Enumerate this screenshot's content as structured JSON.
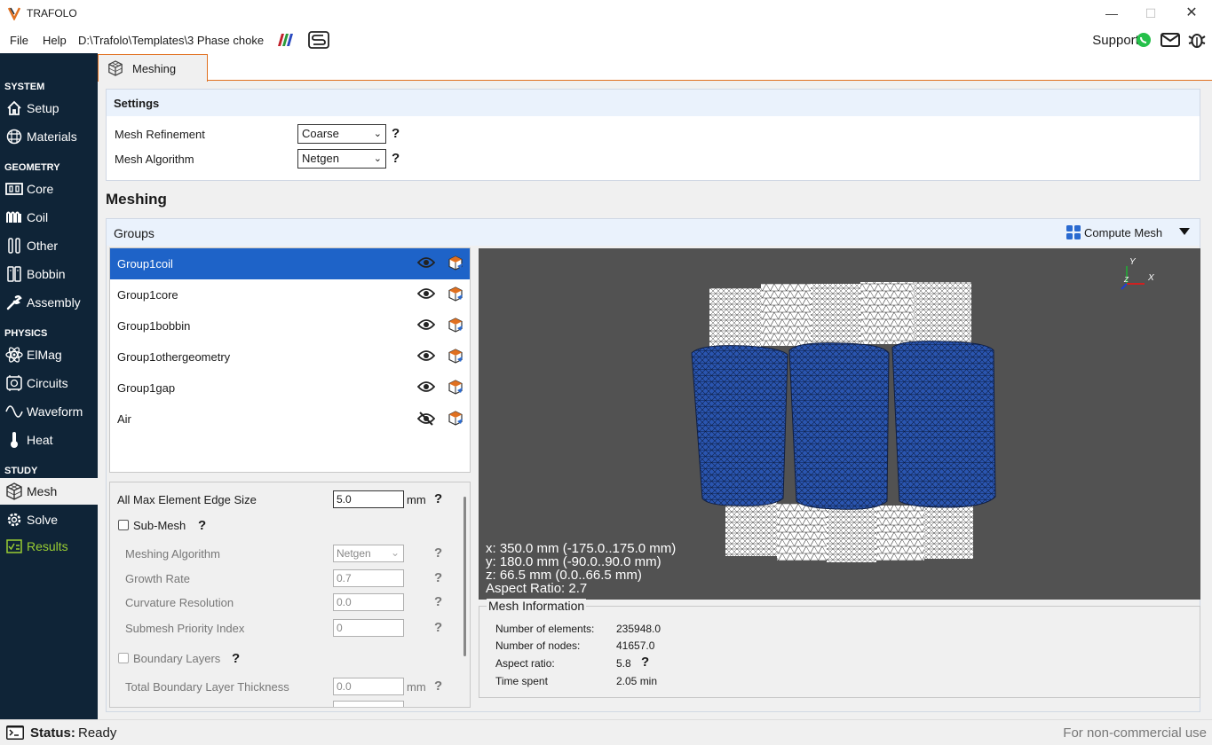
{
  "window": {
    "title": "TRAFOLO",
    "minimize": "—",
    "maximize": "☐",
    "close": "✕"
  },
  "menu": {
    "file": "File",
    "help": "Help",
    "path": "D:\\Trafolo\\Templates\\3 Phase choke",
    "support": "Support:"
  },
  "sidebar": {
    "system": "SYSTEM",
    "geometry": "GEOMETRY",
    "physics": "PHYSICS",
    "study": "STUDY",
    "items": {
      "setup": "Setup",
      "materials": "Materials",
      "core": "Core",
      "coil": "Coil",
      "other": "Other",
      "bobbin": "Bobbin",
      "assembly": "Assembly",
      "elmag": "ElMag",
      "circuits": "Circuits",
      "waveform": "Waveform",
      "heat": "Heat",
      "mesh": "Mesh",
      "solve": "Solve",
      "results": "Results"
    }
  },
  "tab": {
    "label": "Meshing"
  },
  "settings": {
    "title": "Settings",
    "refinement_label": "Mesh Refinement",
    "refinement_value": "Coarse",
    "algorithm_label": "Mesh Algorithm",
    "algorithm_value": "Netgen",
    "help": "?"
  },
  "meshing": {
    "heading": "Meshing",
    "groups_label": "Groups",
    "compute_label": "Compute Mesh",
    "groups": [
      "Group1coil",
      "Group1core",
      "Group1bobbin",
      "Group1othergeometry",
      "Group1gap",
      "Air"
    ]
  },
  "params": {
    "max_edge_label": "All Max Element Edge Size",
    "max_edge_value": "5.0",
    "unit": "mm",
    "submesh_label": "Sub-Mesh",
    "algo_label": "Meshing Algorithm",
    "algo_value": "Netgen",
    "growth_label": "Growth Rate",
    "growth_value": "0.7",
    "curv_label": "Curvature Resolution",
    "curv_value": "0.0",
    "prio_label": "Submesh Priority Index",
    "prio_value": "0",
    "boundary_label": "Boundary Layers",
    "total_bl_label": "Total Boundary Layer Thickness",
    "total_bl_value": "0.0",
    "help": "?"
  },
  "viewport": {
    "x_info": "x: 350.0 mm (-175.0..175.0 mm)",
    "y_info": "y: 180.0 mm (-90.0..90.0 mm)",
    "z_info": "z: 66.5 mm (0.0..66.5 mm)",
    "aspect": "Aspect Ratio: 2.7",
    "axis_x": "X",
    "axis_y": "Y",
    "axis_z": "Z"
  },
  "mesh_info": {
    "title": "Mesh Information",
    "elements_label": "Number of elements:",
    "elements_value": "235948.0",
    "nodes_label": "Number of nodes:",
    "nodes_value": "41657.0",
    "aspect_label": "Aspect ratio:",
    "aspect_value": "5.8",
    "time_label": "Time spent",
    "time_value": "2.05 min",
    "help": "?"
  },
  "status": {
    "label": "Status:",
    "value": "Ready",
    "license": "For non-commercial use"
  },
  "colors": {
    "sidebar_bg": "#0f2437",
    "selection": "#1e63c8",
    "accent": "#e07020",
    "coil_blue": "#2a55b0"
  }
}
